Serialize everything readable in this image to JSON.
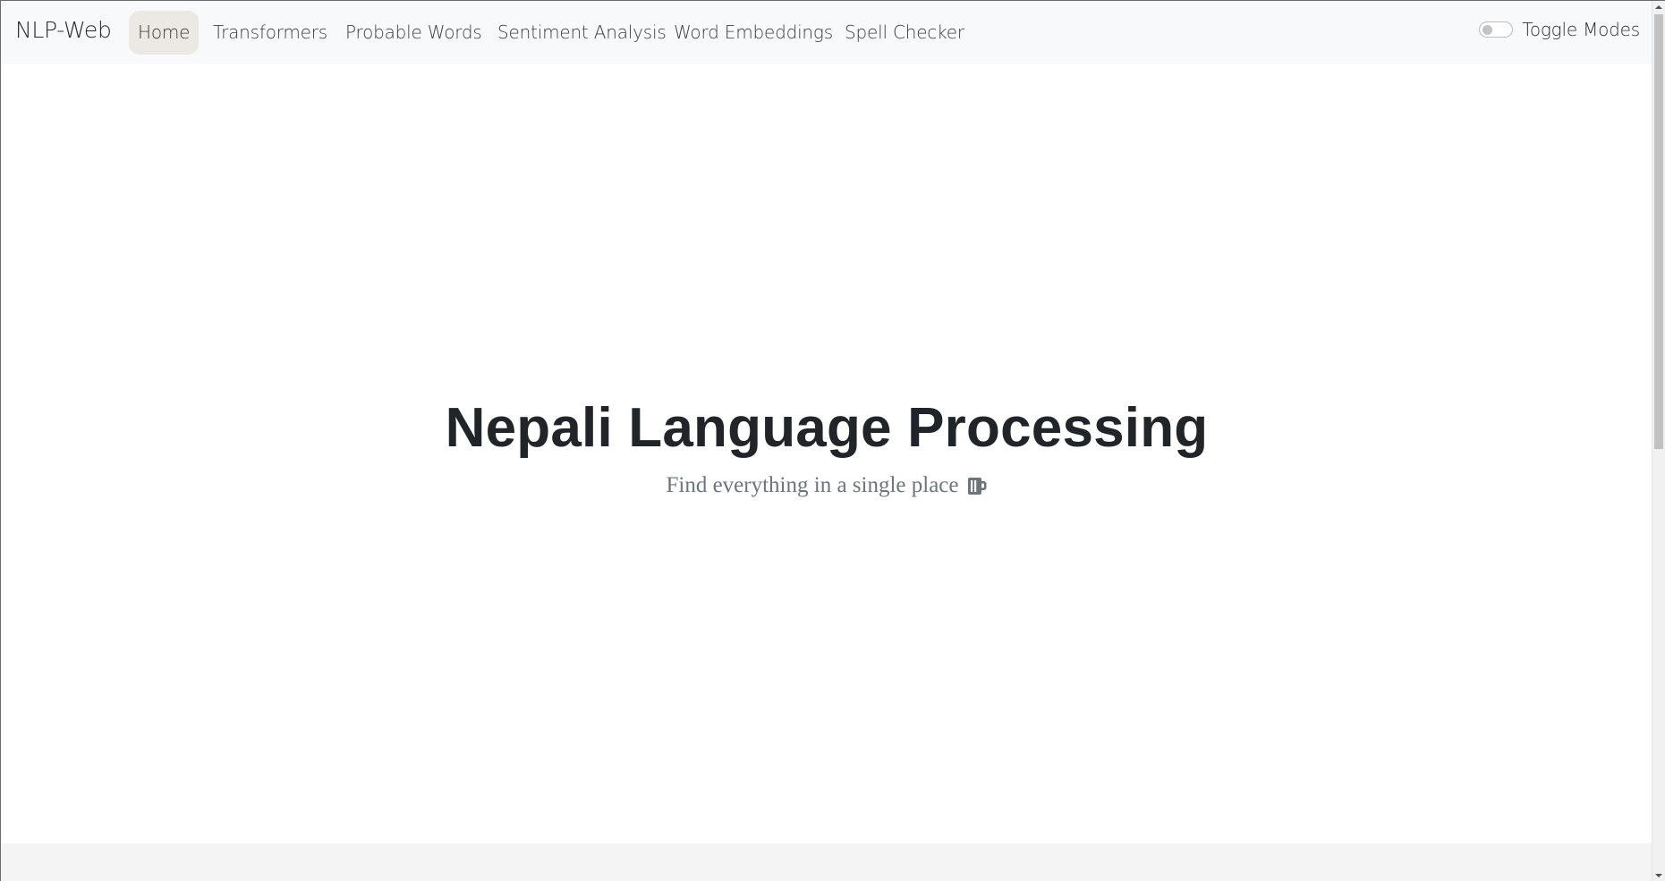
{
  "navbar": {
    "brand": "NLP-Web",
    "links": [
      {
        "label": "Home",
        "active": true
      },
      {
        "label": "Transformers",
        "active": false
      },
      {
        "label": "Probable Words",
        "active": false
      },
      {
        "label": "Sentiment Analysis",
        "active": false
      },
      {
        "label": "Word Embeddings",
        "active": false
      },
      {
        "label": "Spell Checker",
        "active": false
      }
    ],
    "toggle_label": "Toggle Modes",
    "toggle_on": false
  },
  "hero": {
    "title": "Nepali Language Processing",
    "subtitle": "Find everything in a single place",
    "subtitle_icon": "mug-icon"
  },
  "colors": {
    "navbar_bg": "#f8f9fa",
    "active_link_bg": "#ece8e4",
    "title": "#212529",
    "subtitle": "#6c757d"
  }
}
